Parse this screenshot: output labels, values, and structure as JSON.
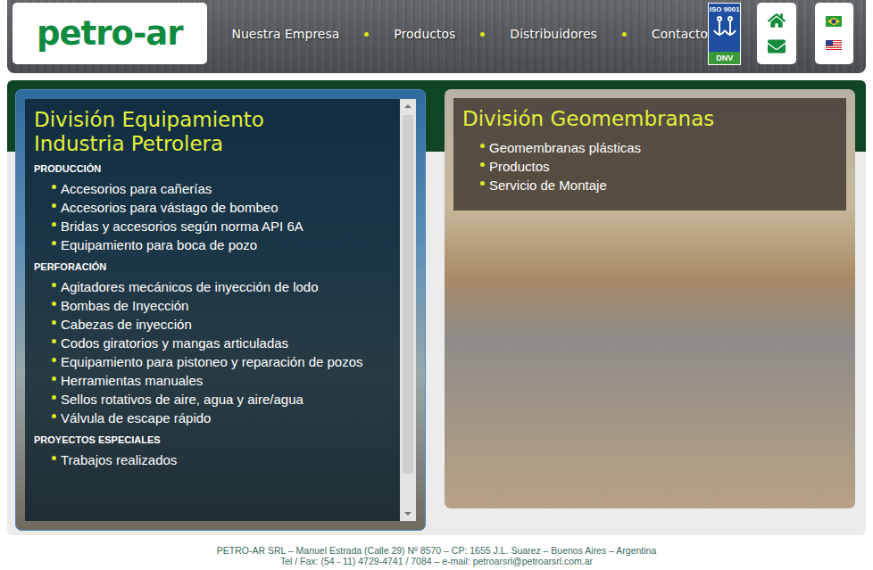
{
  "header": {
    "logo": "petro-ar",
    "nav": [
      {
        "label": "Nuestra Empresa"
      },
      {
        "label": "Productos"
      },
      {
        "label": "Distribuidores"
      },
      {
        "label": "Contacto"
      }
    ],
    "badge": {
      "top": "ISO 9001",
      "bottom": "DNV"
    }
  },
  "divisions": [
    {
      "kind": "sections",
      "title": [
        "División Equipamiento",
        "Industria Petrolera"
      ],
      "scrollbar": {
        "level": 0.92
      },
      "sections": [
        {
          "heading": "PRODUCCIÓN",
          "items": [
            "Accesorios para cañerías",
            "Accesorios para vástago de bombeo",
            "Bridas y accesorios según norma API 6A",
            "Equipamiento para boca de pozo"
          ]
        },
        {
          "heading": "PERFORACIÓN",
          "items": [
            "Agitadores mecánicos de inyección de lodo",
            "Bombas de Inyección",
            "Cabezas de inyección",
            "Codos giratorios y mangas articuladas",
            "Equipamiento para pistoneo y reparación de pozos",
            "Herramientas manuales",
            "Sellos rotativos de aire, agua y aire/agua",
            "Válvula de escape rápido"
          ]
        },
        {
          "heading": "PROYECTOS ESPECIALES",
          "items": [
            "Trabajos realizados"
          ]
        }
      ]
    },
    {
      "kind": "list",
      "title": [
        "División Geomembranas"
      ],
      "items": [
        "Geomembranas plásticas",
        "Productos",
        "Servicio de Montaje"
      ]
    }
  ],
  "footer": {
    "lines": [
      "PETRO-AR SRL – Manuel Estrada (Calle 29) Nº 8570 – CP: 1655 J.L. Suarez – Buenos Aires – Argentina",
      "Tel / Fax: (54 - 11) 4729-4741 / 7084 – e-mail: petroarsrl@petroarsrl.com.ar"
    ]
  }
}
